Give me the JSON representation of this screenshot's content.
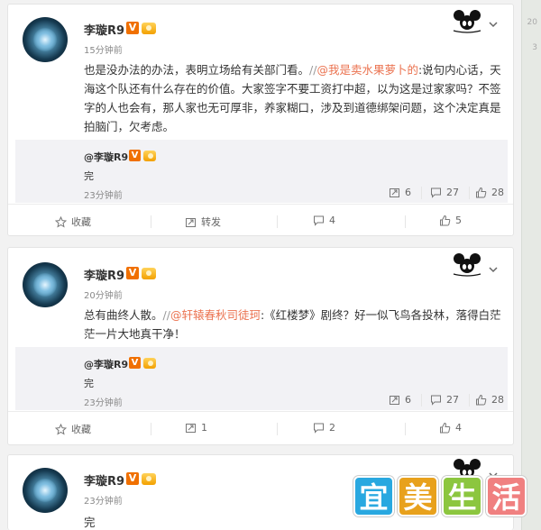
{
  "colors": {
    "accent_link": "#eb7350",
    "badge_orange": "#f07000",
    "quote_bg": "#f2f2f5",
    "watermark": [
      "#29a8e0",
      "#e8a11c",
      "#8cc63f",
      "#f08080"
    ]
  },
  "posts": [
    {
      "author": "李璇R9",
      "verified_badge": "V",
      "time": "15分钟前",
      "text_prefix": "也是没办法的办法，表明立场给有关部门看。",
      "repost_sep": "//",
      "repost_user": "@我是卖水果萝卜的",
      "text_suffix": ":说句内心话，天海这个队还有什么存在的价值。大家签字不要工资打中超，以为这是过家家吗？不签字的人也会有，那人家也无可厚非，养家糊口，涉及到道德绑架问题，这个决定真是拍脑门，欠考虑。",
      "quote": {
        "author": "@李璇R9",
        "text": "完",
        "time": "23分钟前",
        "reposts": "6",
        "comments": "27",
        "likes": "28"
      },
      "actions": {
        "favorite": "收藏",
        "repost": "转发",
        "comment": "4",
        "like": "5"
      }
    },
    {
      "author": "李璇R9",
      "verified_badge": "V",
      "time": "20分钟前",
      "text_prefix": "总有曲终人散。",
      "repost_sep": "//",
      "repost_user": "@轩辕春秋司徒珂",
      "text_suffix": ":《红楼梦》剧终？好一似飞鸟各投林，落得白茫茫一片大地真干净！",
      "quote": {
        "author": "@李璇R9",
        "text": "完",
        "time": "23分钟前",
        "reposts": "6",
        "comments": "27",
        "likes": "28"
      },
      "actions": {
        "favorite": "收藏",
        "repost": "1",
        "comment": "2",
        "like": "4"
      }
    },
    {
      "author": "李璇R9",
      "verified_badge": "V",
      "time": "23分钟前",
      "text": "完"
    }
  ],
  "watermark": [
    "宜",
    "美",
    "生",
    "活"
  ],
  "rail_labels": [
    "20",
    "3"
  ]
}
